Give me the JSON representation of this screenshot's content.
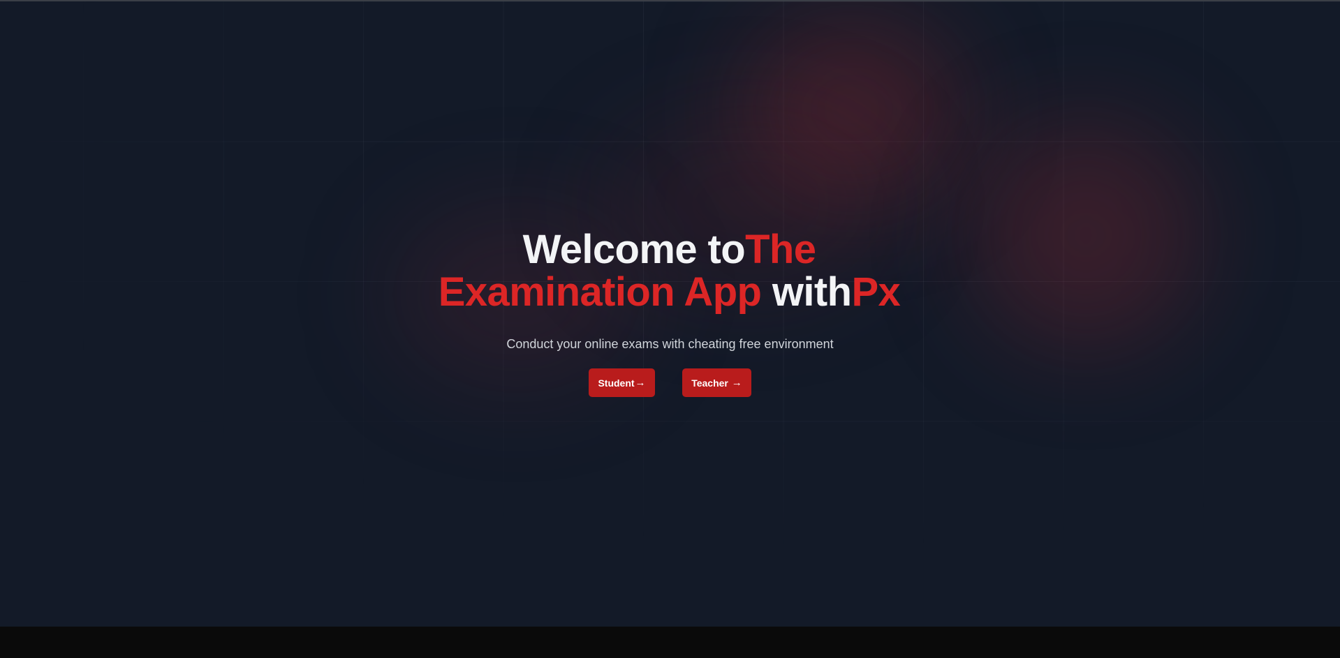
{
  "hero": {
    "title_line1_white": "Welcome to",
    "title_line1_red": "The",
    "title_line2_red": "Examination App",
    "title_line2_white": "with",
    "title_line2_red2": "Px",
    "subtitle": "Conduct your online exams with cheating free environment",
    "buttons": [
      {
        "label": "Student",
        "arrow": "→"
      },
      {
        "label": "Teacher ",
        "arrow": "→"
      }
    ]
  },
  "colors": {
    "background": "#131a28",
    "accent": "#dc2626",
    "button": "#b91c1c",
    "footer": "#0a0a0a"
  }
}
